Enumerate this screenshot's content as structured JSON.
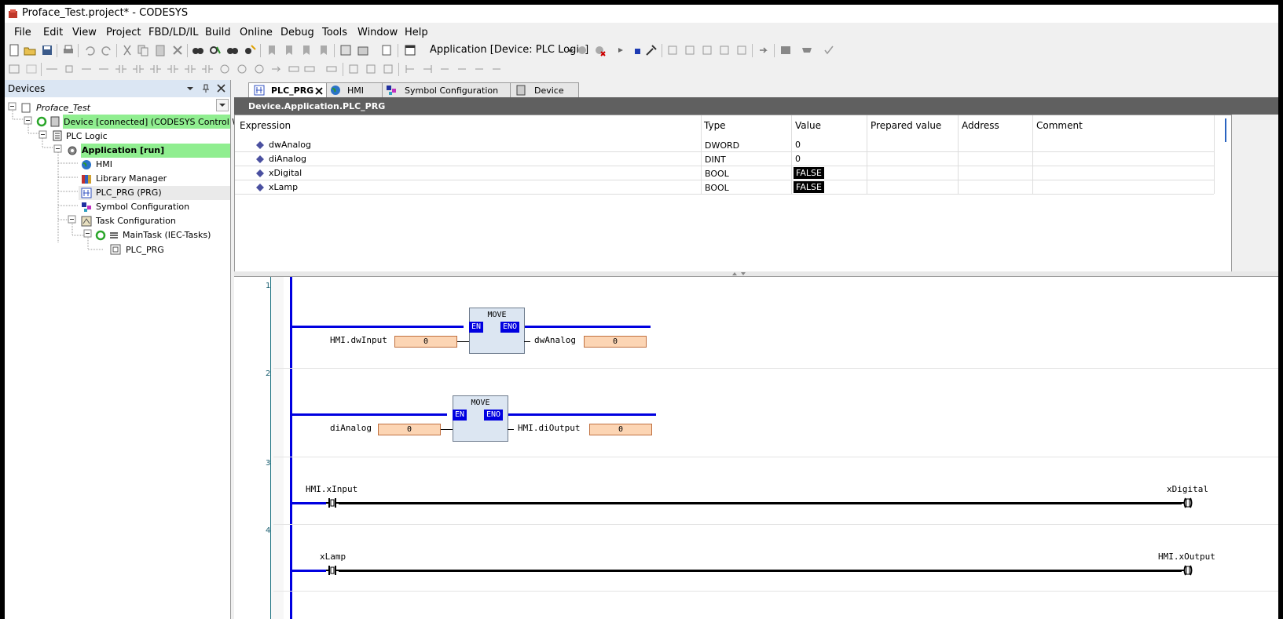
{
  "window": {
    "title": "Proface_Test.project* - CODESYS"
  },
  "menu": [
    "File",
    "Edit",
    "View",
    "Project",
    "FBD/LD/IL",
    "Build",
    "Online",
    "Debug",
    "Tools",
    "Window",
    "Help"
  ],
  "toolbar": {
    "active_application": "Application [Device: PLC Logic]"
  },
  "devices_panel": {
    "title": "Devices",
    "tree": [
      {
        "label": "Proface_Test"
      },
      {
        "label": "Device [connected] (CODESYS Control Win V3"
      },
      {
        "label": "PLC Logic"
      },
      {
        "label": "Application [run]"
      },
      {
        "label": "HMI"
      },
      {
        "label": "Library Manager"
      },
      {
        "label": "PLC_PRG (PRG)"
      },
      {
        "label": "Symbol Configuration"
      },
      {
        "label": "Task Configuration"
      },
      {
        "label": "MainTask (IEC-Tasks)"
      },
      {
        "label": "PLC_PRG"
      }
    ]
  },
  "tabs": [
    {
      "label": "PLC_PRG"
    },
    {
      "label": "HMI"
    },
    {
      "label": "Symbol Configuration"
    },
    {
      "label": "Device"
    }
  ],
  "path": "Device.Application.PLC_PRG",
  "watch": {
    "columns": [
      "Expression",
      "Type",
      "Value",
      "Prepared value",
      "Address",
      "Comment"
    ],
    "rows": [
      {
        "expression": "dwAnalog",
        "type": "DWORD",
        "value": "0"
      },
      {
        "expression": "diAnalog",
        "type": "DINT",
        "value": "0"
      },
      {
        "expression": "xDigital",
        "type": "BOOL",
        "value": "FALSE"
      },
      {
        "expression": "xLamp",
        "type": "BOOL",
        "value": "FALSE"
      }
    ]
  },
  "ladder": {
    "networks": [
      {
        "num": "1",
        "block": "MOVE",
        "en": "EN",
        "eno": "ENO",
        "in_label": "HMI.dwInput",
        "in_value": "0",
        "out_label": "dwAnalog",
        "out_value": "0"
      },
      {
        "num": "2",
        "block": "MOVE",
        "en": "EN",
        "eno": "ENO",
        "in_label": "diAnalog",
        "in_value": "0",
        "out_label": "HMI.diOutput",
        "out_value": "0"
      },
      {
        "num": "3",
        "contact": "HMI.xInput",
        "coil": "xDigital"
      },
      {
        "num": "4",
        "contact": "xLamp",
        "coil": "HMI.xOutput"
      }
    ]
  },
  "colors": {
    "connected_green": "#90ee90",
    "power_rail_blue": "#0000e0",
    "value_box": "#fcd5b4",
    "path_bar": "#606060"
  }
}
